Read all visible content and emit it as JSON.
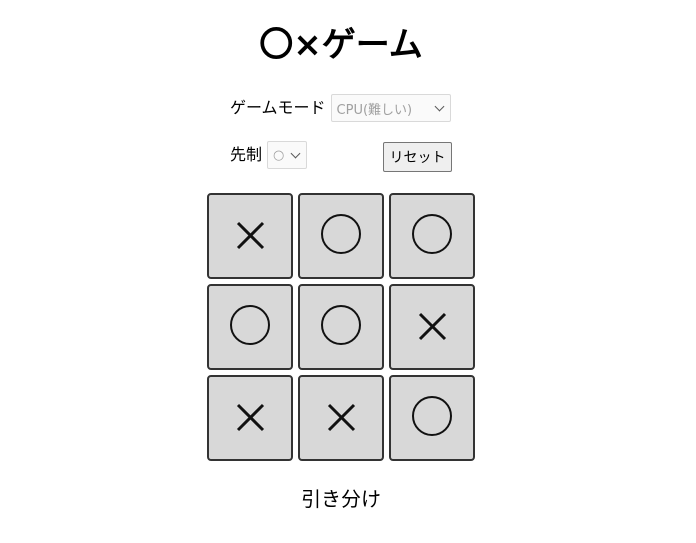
{
  "title": "〇×ゲーム",
  "controls": {
    "mode_label": "ゲームモード",
    "mode_selected": "CPU(難しい)",
    "first_label": "先制",
    "first_selected": "○",
    "reset_label": "リセット"
  },
  "board": {
    "cells": [
      "x",
      "o",
      "o",
      "o",
      "o",
      "x",
      "x",
      "x",
      "o"
    ]
  },
  "result": "引き分け"
}
